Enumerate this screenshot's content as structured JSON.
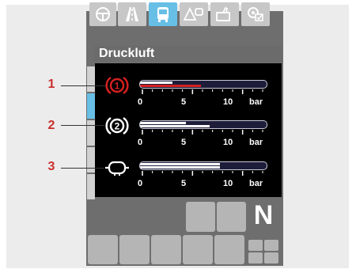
{
  "header": {
    "tabs": [
      {
        "icon": "steering-wheel-icon",
        "active": false
      },
      {
        "icon": "road-icon",
        "active": false
      },
      {
        "icon": "bus-icon",
        "active": true
      },
      {
        "icon": "warning-message-icon",
        "active": false
      },
      {
        "icon": "thumbs-up-icon",
        "active": false
      },
      {
        "icon": "settings-check-icon",
        "active": false
      }
    ]
  },
  "title": "Druckluft",
  "circuits": [
    {
      "callout": "1",
      "icon": "brake-circuit-1-icon",
      "icon_label": "1",
      "icon_color": "#d42020",
      "level_bar": 0.49,
      "level_top": 0.26,
      "bar_color": "#d42020"
    },
    {
      "callout": "2",
      "icon": "brake-circuit-2-icon",
      "icon_label": "2",
      "icon_color": "#ffffff",
      "level_bar": 0.56,
      "level_top": 0.37,
      "bar_color": "#ffffff"
    },
    {
      "callout": "3",
      "icon": "air-supply-icon",
      "icon_label": "",
      "icon_color": "#ffffff",
      "level_bar": 0.64,
      "level_top": 0.64,
      "bar_color": "#ffffff"
    }
  ],
  "scale": {
    "min": "0",
    "mid": "5",
    "max": "10",
    "unit": "bar"
  },
  "gear": "N",
  "colors": {
    "accent": "#68bfe6",
    "warning": "#d42020"
  }
}
